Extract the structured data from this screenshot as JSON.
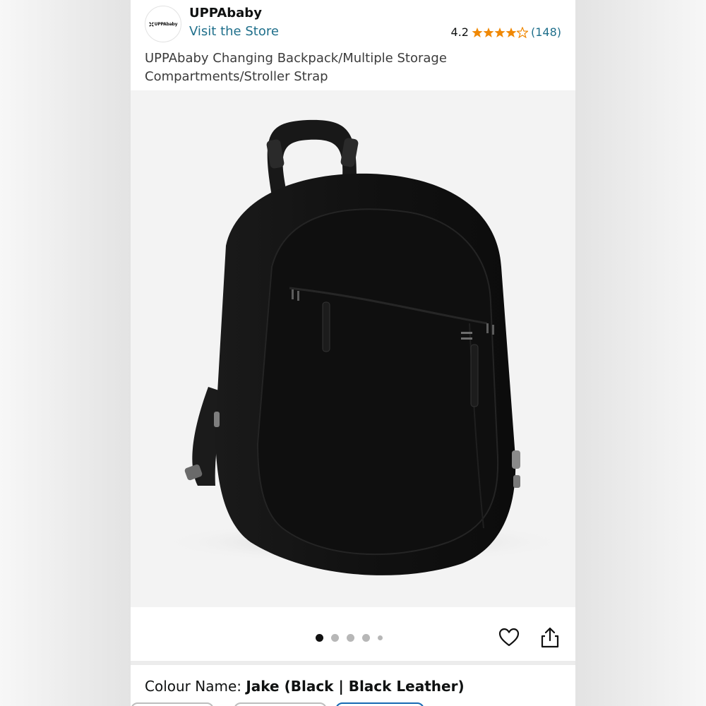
{
  "brand": {
    "logo_text": "UPPAbaby",
    "name": "UPPAbaby",
    "store_link": "Visit the Store"
  },
  "rating": {
    "value": "4.2",
    "stars": 4.2,
    "count": "(148)",
    "star_color": "#f08804"
  },
  "product": {
    "title": "UPPAbaby Changing Backpack/Multiple Storage Compartments/Stroller Strap"
  },
  "gallery": {
    "image_count": 5,
    "active_index": 0
  },
  "actions": {
    "favorite_icon": "heart-icon",
    "share_icon": "share-icon"
  },
  "variant": {
    "label": "Colour Name:",
    "value": "Jake (Black | Black Leather)",
    "selected_color": "#1769b3"
  }
}
